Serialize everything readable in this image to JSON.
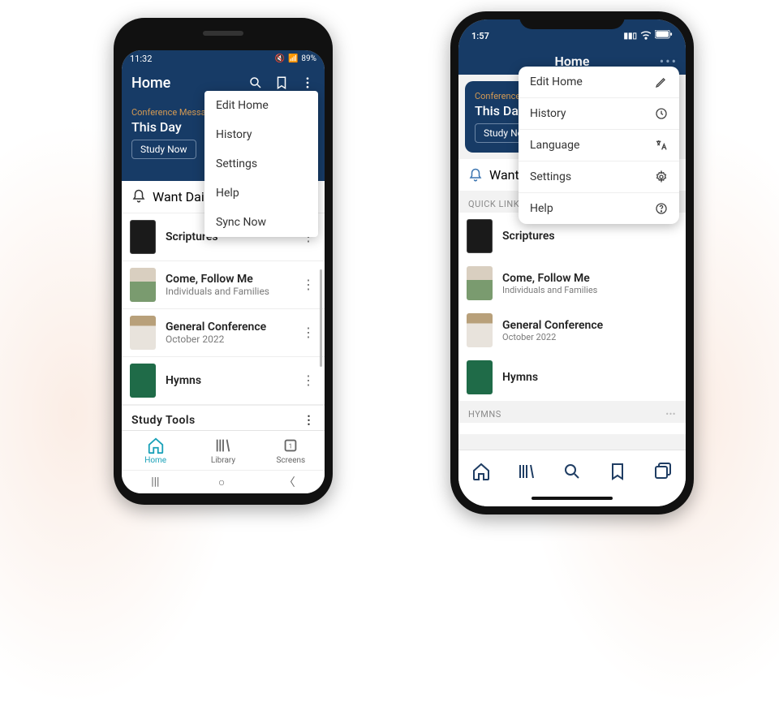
{
  "android": {
    "status_time": "11:32",
    "status_battery": "89%",
    "header_title": "Home",
    "banner": {
      "eyebrow": "Conference Message",
      "title": "This Day",
      "button": "Study Now"
    },
    "bell_text": "Want Daily Inspi",
    "menu": [
      "Edit Home",
      "History",
      "Settings",
      "Help",
      "Sync Now"
    ],
    "links": [
      {
        "title": "Scriptures",
        "sub": ""
      },
      {
        "title": "Come, Follow Me",
        "sub": "Individuals and Families"
      },
      {
        "title": "General Conference",
        "sub": "October 2022"
      },
      {
        "title": "Hymns",
        "sub": ""
      }
    ],
    "section_study_tools": "Study Tools",
    "tabs": {
      "home": "Home",
      "library": "Library",
      "screens": "Screens"
    }
  },
  "ios": {
    "status_time": "1:57",
    "header_title": "Home",
    "banner": {
      "eyebrow": "Conference M",
      "title": "This Day",
      "button": "Study No"
    },
    "bell_text": "Want Da",
    "menu": [
      {
        "label": "Edit Home",
        "icon": "pencil"
      },
      {
        "label": "History",
        "icon": "clock"
      },
      {
        "label": "Language",
        "icon": "translate"
      },
      {
        "label": "Settings",
        "icon": "gear"
      },
      {
        "label": "Help",
        "icon": "question"
      }
    ],
    "section_quick_links": "Quick Links",
    "links": [
      {
        "title": "Scriptures",
        "sub": ""
      },
      {
        "title": "Come, Follow Me",
        "sub": "Individuals and Families"
      },
      {
        "title": "General Conference",
        "sub": "October 2022"
      },
      {
        "title": "Hymns",
        "sub": ""
      }
    ],
    "section_hymns": "Hymns"
  }
}
